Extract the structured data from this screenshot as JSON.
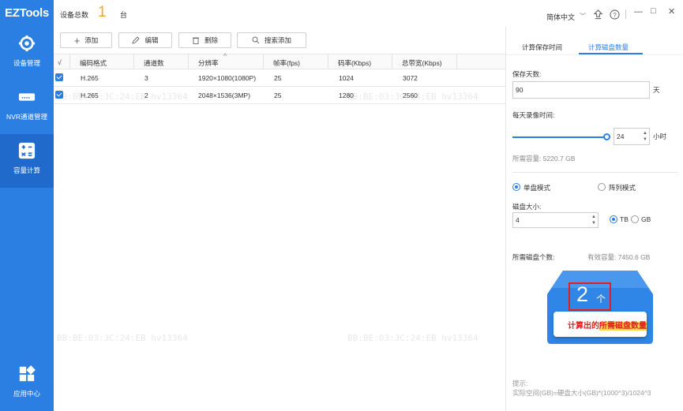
{
  "app": {
    "title": "EZTools"
  },
  "header": {
    "device_total_label": "设备总数",
    "device_total_value": "1",
    "device_total_unit": "台",
    "language": "简体中文"
  },
  "sidebar": {
    "items": [
      {
        "label": "设备管理",
        "icon": "gear-icon"
      },
      {
        "label": "NVR通道管理",
        "icon": "nvr-icon"
      },
      {
        "label": "容量计算",
        "icon": "calculator-icon",
        "active": true
      },
      {
        "label": "应用中心",
        "icon": "apps-grid-icon"
      }
    ]
  },
  "toolbar": {
    "add_label": "添加",
    "edit_label": "编辑",
    "delete_label": "删除",
    "search_add_label": "搜索添加"
  },
  "table": {
    "columns": [
      "√",
      "编码格式",
      "通道数",
      "分辨率",
      "帧率(fps)",
      "码率(Kbps)",
      "总带宽(Kbps)"
    ],
    "rows": [
      {
        "codec": "H.265",
        "channels": "3",
        "resolution": "1920×1080(1080P)",
        "fps": "25",
        "bitrate": "1024",
        "bandwidth": "3072"
      },
      {
        "codec": "H.265",
        "channels": "2",
        "resolution": "2048×1536(3MP)",
        "fps": "25",
        "bitrate": "1280",
        "bandwidth": "2560"
      }
    ]
  },
  "watermark": {
    "text": "BB:BE:03:3C:24:EB hv13364"
  },
  "panel": {
    "tab_time": "计算保存时间",
    "tab_disks": "计算磁盘数量",
    "save_days_label": "保存天数:",
    "save_days_value": "90",
    "days_unit": "天",
    "daily_hours_label": "每天录像时间:",
    "daily_hours_value": "24",
    "hours_unit": "小时",
    "daily_hours_slider_fraction": 1.0,
    "required_capacity": "所需容量: 5220.7 GB",
    "mode_single": "单盘模式",
    "mode_array": "阵列模式",
    "disk_size_label": "磁盘大小:",
    "disk_size_value": "4",
    "unit_tb": "TB",
    "unit_gb": "GB",
    "required_disks_label": "所需磁盘个数:",
    "effective_capacity": "有效容量: 7450.6 GB",
    "disk_count": "2",
    "disk_count_unit": "个",
    "disk_tag_pre": "计算出的",
    "disk_tag_mid": "所需磁盘数量",
    "hint_title": "提示:",
    "hint_body": "实际空间(GB)=硬盘大小(GB)*(1000^3)/1024^3"
  },
  "colors": {
    "accent": "#2b7fe3",
    "highlight": "#e02020",
    "count": "#f5a623"
  }
}
